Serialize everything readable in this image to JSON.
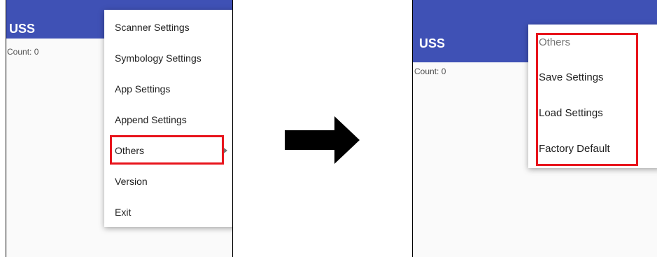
{
  "left_screen": {
    "app_title": "USS",
    "count_text": "Count:  0",
    "menu": {
      "items": [
        {
          "label": "Scanner Settings"
        },
        {
          "label": "Symbology Settings"
        },
        {
          "label": "App Settings"
        },
        {
          "label": "Append Settings"
        },
        {
          "label": "Others",
          "has_submenu": true,
          "highlighted": true
        },
        {
          "label": "Version"
        },
        {
          "label": "Exit"
        }
      ]
    }
  },
  "right_screen": {
    "app_title": "USS",
    "count_text": "Count:  0",
    "submenu": {
      "header": "Others",
      "items": [
        {
          "label": "Save Settings"
        },
        {
          "label": "Load Settings"
        },
        {
          "label": "Factory Default"
        }
      ]
    }
  },
  "colors": {
    "appbar": "#3f51b5",
    "highlight": "#e8141c",
    "arrow": "#000000"
  },
  "icons": {
    "transition": "right-arrow-icon",
    "submenu": "submenu-arrow-icon"
  }
}
